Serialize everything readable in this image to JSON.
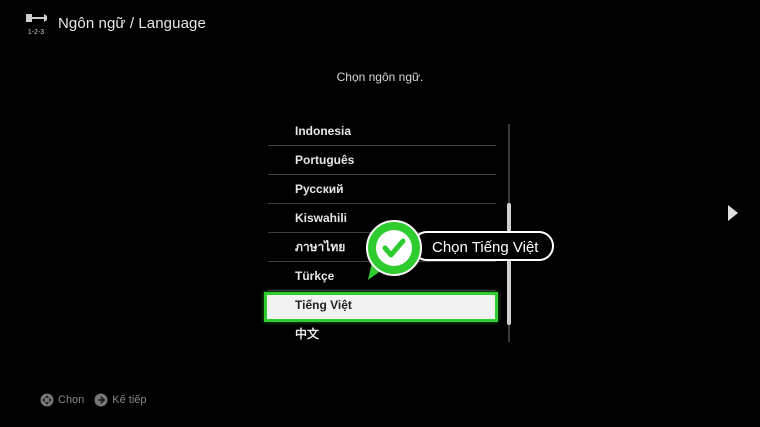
{
  "header": {
    "title": "Ngôn ngữ / Language",
    "icon": "setup-tools-icon",
    "icon_caption": "1-2-3"
  },
  "prompt": "Chọn ngôn ngữ.",
  "languages": [
    {
      "label": "Indonesia"
    },
    {
      "label": "Português"
    },
    {
      "label": "Русский"
    },
    {
      "label": "Kiswahili"
    },
    {
      "label": "ภาษาไทย"
    },
    {
      "label": "Türkçe"
    },
    {
      "label": "Tiếng Việt"
    },
    {
      "label": "中文"
    }
  ],
  "selected_language": "Tiếng Việt",
  "callout": {
    "text": "Chọn Tiếng Việt",
    "icon": "checkmark-icon",
    "color": "#2ecc2e"
  },
  "footer": {
    "select_label": "Chọn",
    "next_label": "Kế tiếp"
  },
  "colors": {
    "background": "#000000",
    "highlight_border": "#2ecc2e",
    "highlight_fill": "#f2f2f2"
  }
}
